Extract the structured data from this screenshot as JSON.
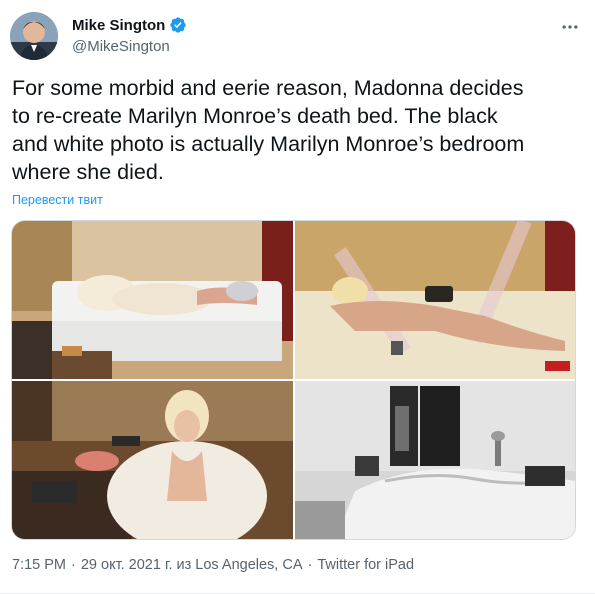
{
  "author": {
    "display_name": "Mike Sington",
    "handle": "@MikeSington",
    "verified": true,
    "avatar_icon": "avatar-photo"
  },
  "more_icon": "more-dots-icon",
  "tweet": {
    "text": "For some morbid and eerie reason, Madonna decides\nto re-create Marilyn Monroe’s death bed. The black\nand white photo is actually Marilyn Monroe’s bedroom\nwhere she died.",
    "translate_label": "Перевести твит"
  },
  "media": {
    "count": 4,
    "images": [
      {
        "icon": "photo-bedroom-color-1"
      },
      {
        "icon": "photo-bed-color-2"
      },
      {
        "icon": "photo-fur-coat-color-3"
      },
      {
        "icon": "photo-bedroom-bw-4"
      }
    ]
  },
  "meta": {
    "time": "7:15 PM",
    "date": "29 окт. 2021 г. из Los Angeles, CA",
    "source": "Twitter for iPad",
    "separator": "·"
  },
  "colors": {
    "link": "#1d9bf0",
    "muted": "#536471",
    "text": "#0f1419",
    "verified": "#1d9bf0"
  }
}
